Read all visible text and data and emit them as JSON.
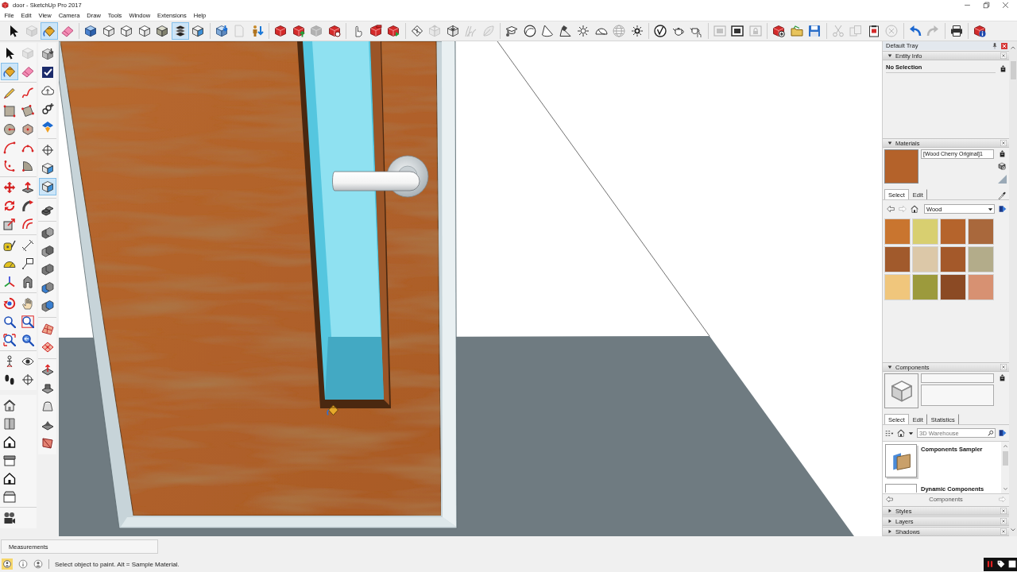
{
  "window": {
    "title": "door - SketchUp Pro 2017"
  },
  "menu": [
    "File",
    "Edit",
    "View",
    "Camera",
    "Draw",
    "Tools",
    "Window",
    "Extensions",
    "Help"
  ],
  "toolbar": {
    "groups": [
      {
        "buttons": [
          {
            "selected": false,
            "disabled": false
          },
          {
            "selected": false,
            "disabled": true
          },
          {
            "selected": true,
            "disabled": false
          },
          {
            "selected": false,
            "disabled": false
          }
        ]
      },
      {
        "buttons": [
          {
            "selected": false,
            "disabled": false
          },
          {
            "selected": false,
            "disabled": false
          },
          {
            "selected": false,
            "disabled": false
          },
          {
            "selected": false,
            "disabled": false
          },
          {
            "selected": false,
            "disabled": false
          },
          {
            "selected": true,
            "disabled": false
          },
          {
            "selected": false,
            "disabled": false
          }
        ]
      },
      {
        "buttons": [
          {
            "selected": false,
            "disabled": false
          },
          {
            "selected": false,
            "disabled": true
          },
          {
            "selected": false,
            "disabled": false
          }
        ]
      },
      {
        "buttons": [
          {
            "selected": false,
            "disabled": false
          },
          {
            "selected": false,
            "disabled": false
          },
          {
            "selected": false,
            "disabled": true
          },
          {
            "selected": false,
            "disabled": false
          }
        ]
      },
      {
        "buttons": [
          {
            "selected": false,
            "disabled": false
          },
          {
            "selected": false,
            "disabled": false
          },
          {
            "selected": false,
            "disabled": false
          }
        ]
      },
      {
        "buttons": [
          {
            "selected": false,
            "disabled": false
          },
          {
            "selected": false,
            "disabled": true
          },
          {
            "selected": false,
            "disabled": false
          },
          {
            "selected": false,
            "disabled": true
          },
          {
            "selected": false,
            "disabled": true
          }
        ]
      },
      {
        "buttons": [
          {
            "selected": false,
            "disabled": false
          },
          {
            "selected": false,
            "disabled": false
          },
          {
            "selected": false,
            "disabled": false
          },
          {
            "selected": false,
            "disabled": false
          },
          {
            "selected": false,
            "disabled": false
          },
          {
            "selected": false,
            "disabled": false
          },
          {
            "selected": false,
            "disabled": true
          },
          {
            "selected": false,
            "disabled": false
          }
        ]
      },
      {
        "buttons": [
          {
            "selected": false,
            "disabled": false
          },
          {
            "selected": false,
            "disabled": false
          },
          {
            "selected": false,
            "disabled": false
          }
        ]
      },
      {
        "buttons": [
          {
            "selected": false,
            "disabled": true
          },
          {
            "selected": false,
            "disabled": false
          },
          {
            "selected": false,
            "disabled": true
          }
        ]
      },
      {
        "buttons": [
          {
            "selected": false,
            "disabled": false
          },
          {
            "selected": false,
            "disabled": false
          },
          {
            "selected": false,
            "disabled": false
          }
        ]
      },
      {
        "buttons": [
          {
            "selected": false,
            "disabled": true
          },
          {
            "selected": false,
            "disabled": true
          },
          {
            "selected": false,
            "disabled": false
          },
          {
            "selected": false,
            "disabled": true
          }
        ]
      },
      {
        "buttons": [
          {
            "selected": false,
            "disabled": false
          },
          {
            "selected": false,
            "disabled": true
          }
        ]
      },
      {
        "buttons": [
          {
            "selected": false,
            "disabled": false
          }
        ]
      },
      {
        "buttons": [
          {
            "selected": false,
            "disabled": false
          }
        ]
      }
    ]
  },
  "tool_palette": {
    "groups": [
      {
        "buttons": [
          {
            "selected": false,
            "disabled": false
          },
          {
            "selected": false,
            "disabled": true
          },
          {
            "selected": true,
            "disabled": false
          },
          {
            "selected": false,
            "disabled": false
          }
        ]
      },
      {
        "buttons": [
          {
            "selected": false,
            "disabled": false
          },
          {
            "selected": false,
            "disabled": false
          },
          {
            "selected": false,
            "disabled": false
          },
          {
            "selected": false,
            "disabled": false
          },
          {
            "selected": false,
            "disabled": false
          },
          {
            "selected": false,
            "disabled": false
          },
          {
            "selected": false,
            "disabled": false
          },
          {
            "selected": false,
            "disabled": false
          },
          {
            "selected": false,
            "disabled": false
          },
          {
            "selected": false,
            "disabled": false
          }
        ]
      },
      {
        "buttons": [
          {
            "selected": false,
            "disabled": false
          },
          {
            "selected": false,
            "disabled": false
          },
          {
            "selected": false,
            "disabled": false
          },
          {
            "selected": false,
            "disabled": false
          },
          {
            "selected": false,
            "disabled": false
          },
          {
            "selected": false,
            "disabled": false
          }
        ]
      },
      {
        "buttons": [
          {
            "selected": false,
            "disabled": false
          },
          {
            "selected": false,
            "disabled": false
          },
          {
            "selected": false,
            "disabled": false
          },
          {
            "selected": false,
            "disabled": false
          },
          {
            "selected": false,
            "disabled": false
          },
          {
            "selected": false,
            "disabled": false
          }
        ]
      },
      {
        "buttons": [
          {
            "selected": false,
            "disabled": false
          },
          {
            "selected": false,
            "disabled": false
          },
          {
            "selected": false,
            "disabled": false
          },
          {
            "selected": false,
            "disabled": false
          },
          {
            "selected": false,
            "disabled": false
          },
          {
            "selected": false,
            "disabled": false
          }
        ]
      },
      {
        "buttons": [
          {
            "selected": false,
            "disabled": false
          },
          {
            "selected": false,
            "disabled": false
          },
          {
            "selected": false,
            "disabled": false
          },
          {
            "selected": false,
            "disabled": false
          }
        ]
      }
    ]
  },
  "extra_toolbar": {
    "groups": [
      {
        "buttons": [
          {
            "selected": false,
            "disabled": false
          },
          {
            "selected": false,
            "disabled": false
          },
          {
            "selected": false,
            "disabled": false
          },
          {
            "selected": false,
            "disabled": false
          },
          {
            "selected": false,
            "disabled": false
          },
          {
            "selected": false,
            "disabled": false
          }
        ]
      },
      {
        "buttons": [
          {
            "selected": false,
            "disabled": false
          }
        ]
      }
    ]
  },
  "side_toolbar": {
    "groups": [
      {
        "buttons": [
          {
            "selected": false,
            "disabled": false
          },
          {
            "selected": false,
            "disabled": false
          },
          {
            "selected": false,
            "disabled": false
          },
          {
            "selected": false,
            "disabled": false
          },
          {
            "selected": false,
            "disabled": false
          }
        ]
      },
      {
        "buttons": [
          {
            "selected": false,
            "disabled": false
          },
          {
            "selected": false,
            "disabled": false
          },
          {
            "selected": true,
            "disabled": false
          }
        ]
      },
      {
        "buttons": [
          {
            "selected": false,
            "disabled": false
          }
        ]
      },
      {
        "buttons": [
          {
            "selected": false,
            "disabled": false
          },
          {
            "selected": false,
            "disabled": false
          },
          {
            "selected": false,
            "disabled": false
          },
          {
            "selected": false,
            "disabled": false
          },
          {
            "selected": false,
            "disabled": false
          }
        ]
      },
      {
        "buttons": [
          {
            "selected": false,
            "disabled": false
          },
          {
            "selected": false,
            "disabled": false
          }
        ]
      },
      {
        "buttons": [
          {
            "selected": false,
            "disabled": false
          },
          {
            "selected": false,
            "disabled": false
          },
          {
            "selected": false,
            "disabled": false
          },
          {
            "selected": false,
            "disabled": false
          },
          {
            "selected": false,
            "disabled": false
          }
        ]
      }
    ]
  },
  "tray": {
    "title": "Default Tray",
    "panels": [
      {
        "kind": "entity_info",
        "title": "Entity Info",
        "expanded": true,
        "selection": "No Selection"
      },
      {
        "kind": "materials",
        "title": "Materials",
        "expanded": true,
        "material": {
          "name": "[Wood Cherry Original]1",
          "color": "#b4622a"
        },
        "tabs": [
          {
            "label": "Select",
            "selected": true
          },
          {
            "label": "Edit",
            "selected": false
          }
        ],
        "library": "Wood",
        "swatches": [
          {
            "color": "#c9752f"
          },
          {
            "color": "#d8cf70"
          },
          {
            "color": "#b5642c"
          },
          {
            "color": "#a9683c"
          },
          {
            "color": "#a15a2c"
          },
          {
            "color": "#dcc8a8"
          },
          {
            "color": "#a4592a"
          },
          {
            "color": "#b3ac8a"
          },
          {
            "color": "#f0c67c"
          },
          {
            "color": "#9c9a3c"
          },
          {
            "color": "#8b4a24"
          },
          {
            "color": "#d79172"
          }
        ]
      },
      {
        "kind": "components",
        "title": "Components",
        "expanded": true,
        "tabs": [
          {
            "label": "Select",
            "selected": true
          },
          {
            "label": "Edit",
            "selected": false
          },
          {
            "label": "Statistics",
            "selected": false
          }
        ],
        "search": {
          "placeholder": "3D Warehouse"
        },
        "items": [
          {
            "name": "Components Sampler"
          },
          {
            "name": "Dynamic Components"
          }
        ],
        "footer": "Components"
      },
      {
        "title": "Styles",
        "expanded": false
      },
      {
        "title": "Layers",
        "expanded": false
      },
      {
        "title": "Shadows",
        "expanded": false
      }
    ]
  },
  "measurements": {
    "label": "Measurements"
  },
  "status_bar": {
    "message": "Select object to paint. Alt = Sample Material."
  }
}
